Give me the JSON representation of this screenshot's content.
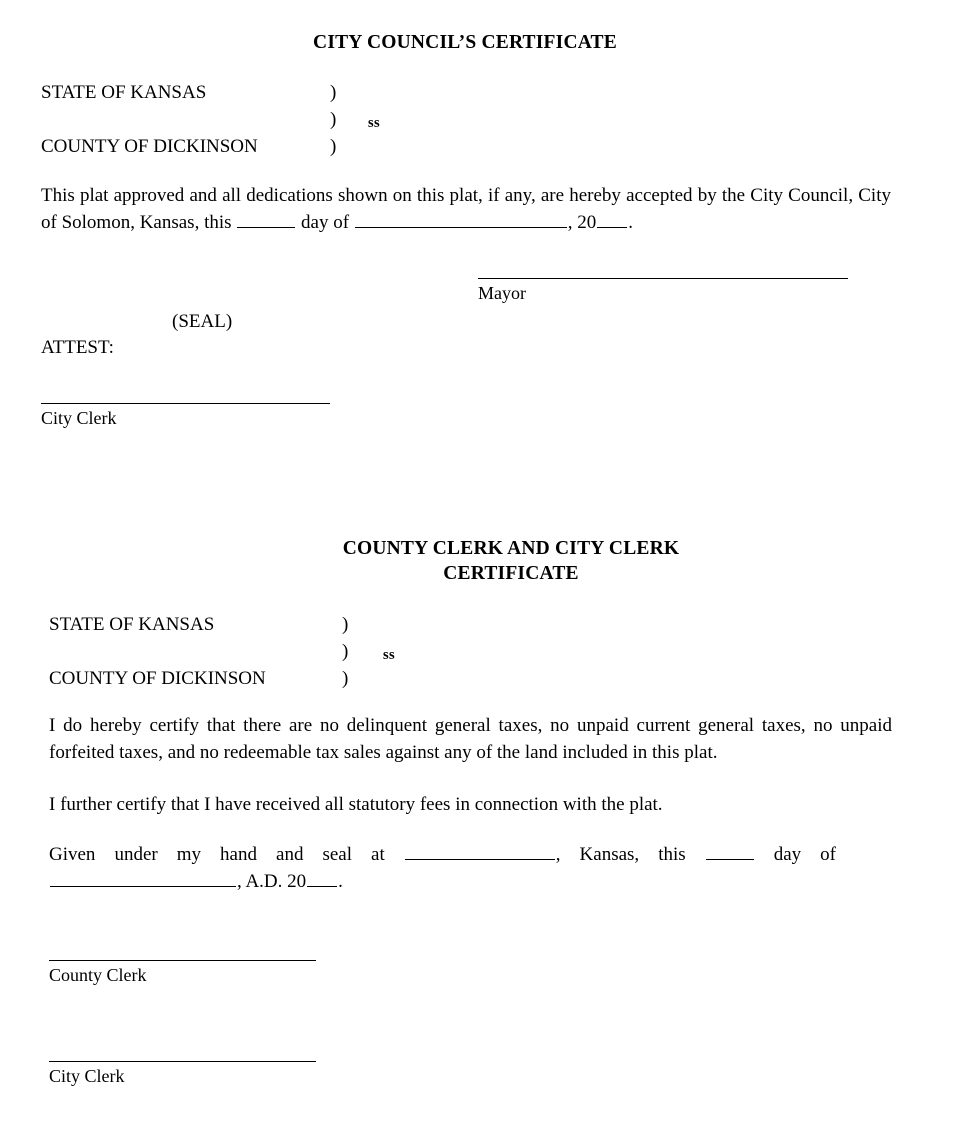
{
  "document": {
    "type": "plat-certificate-form",
    "background_color": "#ffffff",
    "text_color": "#000000"
  },
  "council_certificate": {
    "title": "CITY COUNCIL’S CERTIFICATE",
    "venue": {
      "state_line": "STATE OF KANSAS",
      "county_line": "COUNTY OF DICKINSON",
      "paren": ")",
      "ss": "ss"
    },
    "body": {
      "segment_1": "This plat approved and all dedications shown on this plat, if any, are hereby accepted by the City Council, City of Solomon, Kansas, this ",
      "segment_2": " day of ",
      "segment_3": ", 20",
      "segment_4": "."
    },
    "mayor_signature_label": "Mayor",
    "seal_label": "(SEAL)",
    "attest_label": "ATTEST:",
    "city_clerk_signature_label": "City Clerk"
  },
  "clerks_certificate": {
    "title": "COUNTY CLERK AND CITY CLERK\nCERTIFICATE",
    "venue": {
      "state_line": "STATE OF KANSAS",
      "county_line": "COUNTY OF DICKINSON",
      "paren": ")",
      "ss": "ss"
    },
    "paragraph_taxes": "I do hereby certify that there are no delinquent general taxes, no unpaid current general taxes, no unpaid forfeited taxes, and no redeemable tax sales against any of the land included in this plat.",
    "paragraph_fees": "I further certify that I have received all statutory fees in connection with the plat.",
    "paragraph_given": {
      "segment_1": "Given under my hand and seal at ",
      "segment_2": ", Kansas, this ",
      "segment_3": " day of ",
      "segment_4": ", A.D. 20",
      "segment_5": "."
    },
    "county_clerk_signature_label": "County Clerk",
    "city_clerk_signature_label": "City Clerk"
  }
}
